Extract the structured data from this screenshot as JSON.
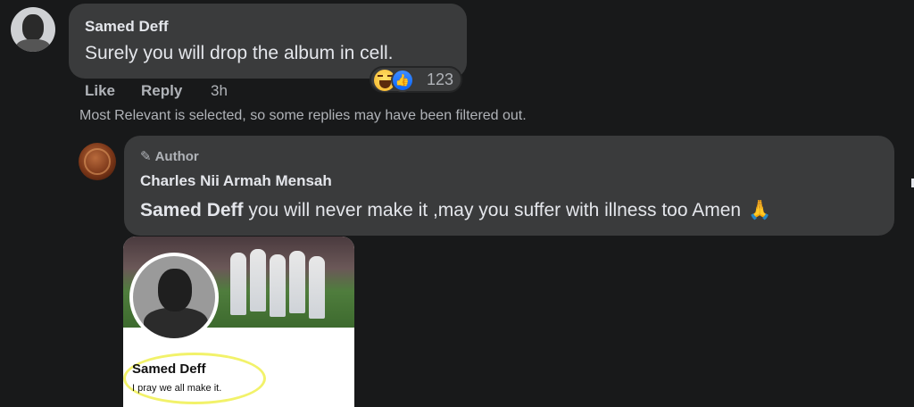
{
  "comment": {
    "author": "Samed Deff",
    "text": "Surely you will drop the album in cell.",
    "reactions": {
      "icons": [
        "haha-icon",
        "like-icon"
      ],
      "count": "123"
    },
    "actions": {
      "like": "Like",
      "reply": "Reply",
      "time": "3h"
    }
  },
  "filter_note": "Most Relevant is selected, so some replies may have been filtered out.",
  "reply": {
    "badge": "Author",
    "author": "Charles Nii Armah Mensah",
    "mention": "Samed Deff",
    "text": " you will never make it ,may you suffer with illness too Amen",
    "emoji": "🙏",
    "attachment": {
      "name": "Samed Deff",
      "caption": "I pray we all make it."
    }
  },
  "colors": {
    "background": "#18191a",
    "bubble": "#3a3b3c",
    "text": "#e4e6eb",
    "secondary_text": "#b0b3b8",
    "like_blue": "#0866ff"
  }
}
